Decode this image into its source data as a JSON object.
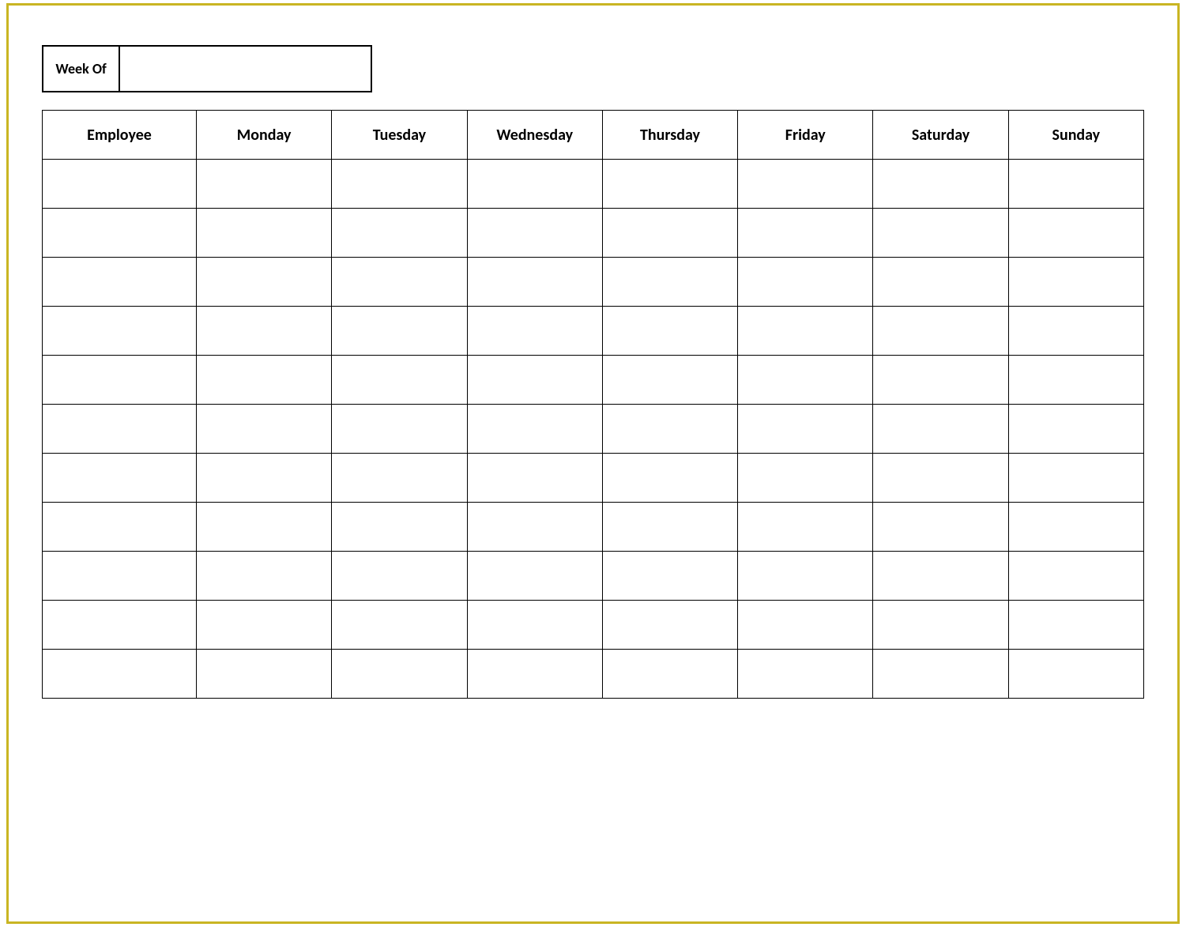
{
  "week_of": {
    "label": "Week Of",
    "value": ""
  },
  "columns": [
    "Employee",
    "Monday",
    "Tuesday",
    "Wednesday",
    "Thursday",
    "Friday",
    "Saturday",
    "Sunday"
  ],
  "rows": [
    [
      "",
      "",
      "",
      "",
      "",
      "",
      "",
      ""
    ],
    [
      "",
      "",
      "",
      "",
      "",
      "",
      "",
      ""
    ],
    [
      "",
      "",
      "",
      "",
      "",
      "",
      "",
      ""
    ],
    [
      "",
      "",
      "",
      "",
      "",
      "",
      "",
      ""
    ],
    [
      "",
      "",
      "",
      "",
      "",
      "",
      "",
      ""
    ],
    [
      "",
      "",
      "",
      "",
      "",
      "",
      "",
      ""
    ],
    [
      "",
      "",
      "",
      "",
      "",
      "",
      "",
      ""
    ],
    [
      "",
      "",
      "",
      "",
      "",
      "",
      "",
      ""
    ],
    [
      "",
      "",
      "",
      "",
      "",
      "",
      "",
      ""
    ],
    [
      "",
      "",
      "",
      "",
      "",
      "",
      "",
      ""
    ],
    [
      "",
      "",
      "",
      "",
      "",
      "",
      "",
      ""
    ]
  ]
}
